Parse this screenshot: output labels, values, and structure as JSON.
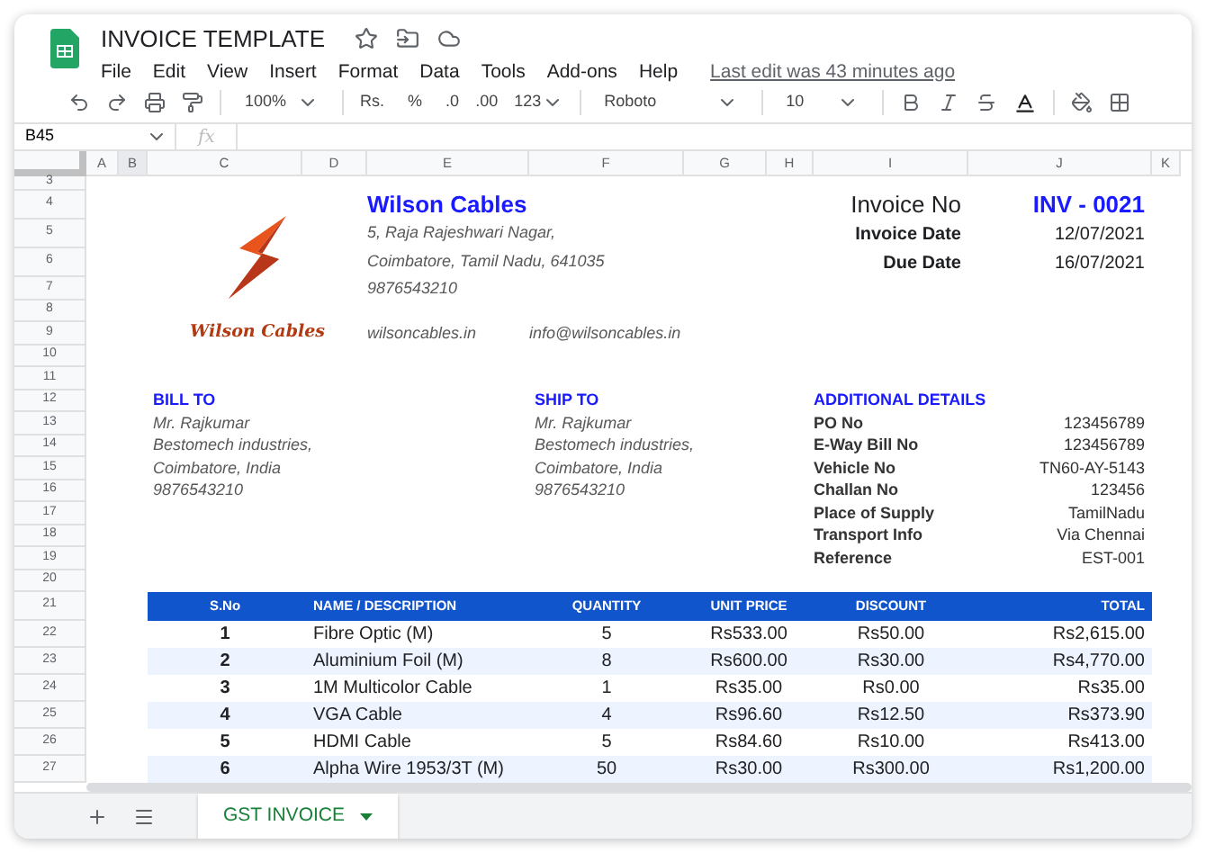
{
  "app": {
    "title": "INVOICE TEMPLATE",
    "menus": [
      "File",
      "Edit",
      "View",
      "Insert",
      "Format",
      "Data",
      "Tools",
      "Add-ons",
      "Help"
    ],
    "last_edit": "Last edit was 43 minutes ago"
  },
  "toolbar": {
    "zoom": "100%",
    "currency": "Rs.",
    "percent": "%",
    "decrease_decimal": ".0",
    "increase_decimal": ".00",
    "number_format": "123",
    "font": "Roboto",
    "font_size": "10"
  },
  "formula_bar": {
    "cell_ref": "B45",
    "fx": "fx"
  },
  "columns": [
    "A",
    "B",
    "C",
    "D",
    "E",
    "F",
    "G",
    "H",
    "I",
    "J",
    "K"
  ],
  "row_numbers": [
    "3",
    "4",
    "5",
    "6",
    "7",
    "8",
    "9",
    "10",
    "11",
    "12",
    "13",
    "14",
    "15",
    "16",
    "17",
    "18",
    "19",
    "20",
    "21",
    "22",
    "23",
    "24",
    "25",
    "26",
    "27"
  ],
  "company": {
    "logo_text": "Wilson Cables",
    "name": "Wilson Cables",
    "address_lines": [
      "5, Raja Rajeshwari Nagar,",
      "Coimbatore, Tamil Nadu, 641035"
    ],
    "phone": "9876543210",
    "website": "wilsoncables.in",
    "email": "info@wilsoncables.in"
  },
  "invoice": {
    "number_label": "Invoice No",
    "number": "INV - 0021",
    "fields": [
      {
        "label": "Invoice Date",
        "value": "12/07/2021"
      },
      {
        "label": "Due Date",
        "value": "16/07/2021"
      }
    ]
  },
  "bill_to": {
    "heading": "BILL TO",
    "lines": [
      "Mr. Rajkumar",
      "Bestomech industries,",
      "Coimbatore, India",
      "9876543210"
    ]
  },
  "ship_to": {
    "heading": "SHIP TO",
    "lines": [
      "Mr. Rajkumar",
      "Bestomech industries,",
      "Coimbatore, India",
      "9876543210"
    ]
  },
  "additional_details": {
    "heading": "ADDITIONAL DETAILS",
    "fields": [
      {
        "label": "PO No",
        "value": "123456789"
      },
      {
        "label": "E-Way Bill No",
        "value": "123456789"
      },
      {
        "label": "Vehicle No",
        "value": "TN60-AY-5143"
      },
      {
        "label": "Challan No",
        "value": "123456"
      },
      {
        "label": "Place of Supply",
        "value": "TamilNadu"
      },
      {
        "label": "Transport Info",
        "value": "Via Chennai"
      },
      {
        "label": "Reference",
        "value": "EST-001"
      }
    ]
  },
  "items_table": {
    "columns": [
      "S.No",
      "NAME / DESCRIPTION",
      "QUANTITY",
      "UNIT PRICE",
      "DISCOUNT",
      "TOTAL"
    ],
    "rows": [
      [
        "1",
        "Fibre Optic (M)",
        "5",
        "Rs533.00",
        "Rs50.00",
        "Rs2,615.00"
      ],
      [
        "2",
        "Aluminium Foil (M)",
        "8",
        "Rs600.00",
        "Rs30.00",
        "Rs4,770.00"
      ],
      [
        "3",
        "1M Multicolor Cable",
        "1",
        "Rs35.00",
        "Rs0.00",
        "Rs35.00"
      ],
      [
        "4",
        "VGA Cable",
        "4",
        "Rs96.60",
        "Rs12.50",
        "Rs373.90"
      ],
      [
        "5",
        "HDMI Cable",
        "5",
        "Rs84.60",
        "Rs10.00",
        "Rs413.00"
      ],
      [
        "6",
        "Alpha Wire 1953/3T (M)",
        "50",
        "Rs30.00",
        "Rs300.00",
        "Rs1,200.00"
      ]
    ]
  },
  "sheet_tabs": [
    {
      "label": "GST INVOICE",
      "selected": true
    }
  ]
}
